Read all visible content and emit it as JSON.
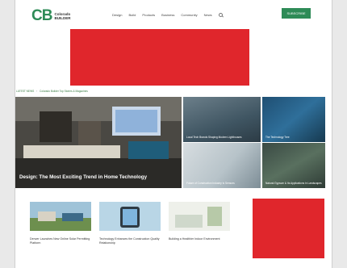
{
  "header": {
    "logo_mark": "CB",
    "logo_line1": "Colorado",
    "logo_line2": "BUILDER",
    "nav": [
      "Design",
      "Build",
      "Products",
      "Business",
      "Community",
      "News"
    ],
    "subscribe_label": "SUBSCRIBE"
  },
  "breadcrumb": {
    "root": "LATEST NEWS",
    "path": "Colorado Builder Top Stories & Magazines"
  },
  "featured": {
    "title": "Design: The Most Exciting Trend in Home Technology"
  },
  "tiles": [
    {
      "title": "Local Tech Brands Shaping Modern Lighthouses"
    },
    {
      "title": "The Technology Tree"
    },
    {
      "title": "Future of Construction Industry Is Sensors"
    },
    {
      "title": "Natural Gypsum & Its Applications in Landscapes"
    }
  ],
  "cards": [
    {
      "title": "Denver Launches New Online Solar Permitting Platform"
    },
    {
      "title": "Technology Enhances the Construction Quality Relationship"
    },
    {
      "title": "Building a Healthier Indoor Environment"
    }
  ],
  "colors": {
    "accent": "#2e8b57",
    "ad": "#e0262c"
  }
}
